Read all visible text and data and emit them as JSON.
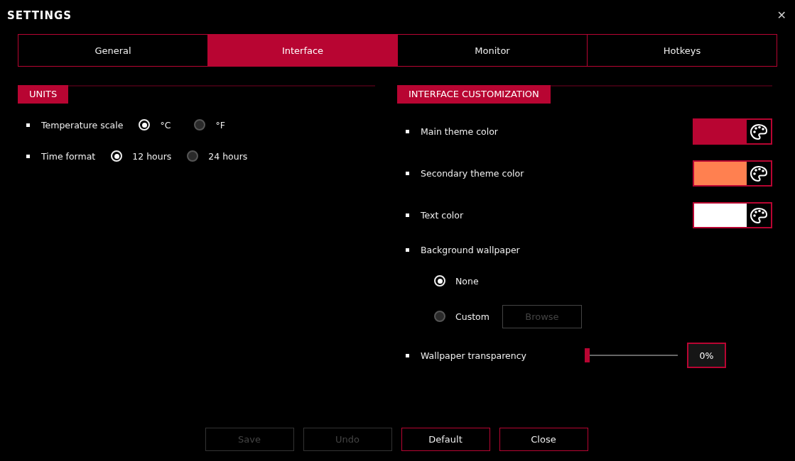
{
  "window": {
    "title": "SETTINGS",
    "close": "✕"
  },
  "tabs": [
    {
      "label": "General",
      "selected": false
    },
    {
      "label": "Interface",
      "selected": true
    },
    {
      "label": "Monitor",
      "selected": false
    },
    {
      "label": "Hotkeys",
      "selected": false
    }
  ],
  "units": {
    "title": "UNITS",
    "rows": [
      {
        "label": "Temperature scale",
        "options": [
          {
            "label": "°C",
            "selected": true
          },
          {
            "label": "°F",
            "selected": false
          }
        ]
      },
      {
        "label": "Time format",
        "options": [
          {
            "label": "12 hours",
            "selected": true
          },
          {
            "label": "24 hours",
            "selected": false
          }
        ]
      }
    ]
  },
  "customization": {
    "title": "INTERFACE CUSTOMIZATION",
    "colors": [
      {
        "label": "Main theme color",
        "color": "#b80532"
      },
      {
        "label": "Secondary theme color",
        "color": "#ff8050"
      },
      {
        "label": "Text color",
        "color": "#ffffff"
      }
    ],
    "wallpaper": {
      "label": "Background wallpaper",
      "options": [
        {
          "label": "None",
          "selected": true
        },
        {
          "label": "Custom",
          "selected": false
        }
      ],
      "browse": {
        "label": "Browse",
        "disabled": true
      }
    },
    "transparency": {
      "label": "Wallpaper transparency",
      "level": 0,
      "reading": "0%"
    }
  },
  "buttons": [
    {
      "label": "Save",
      "disabled": true
    },
    {
      "label": "Undo",
      "disabled": true
    },
    {
      "label": "Default",
      "disabled": false
    },
    {
      "label": "Close",
      "disabled": false
    }
  ]
}
